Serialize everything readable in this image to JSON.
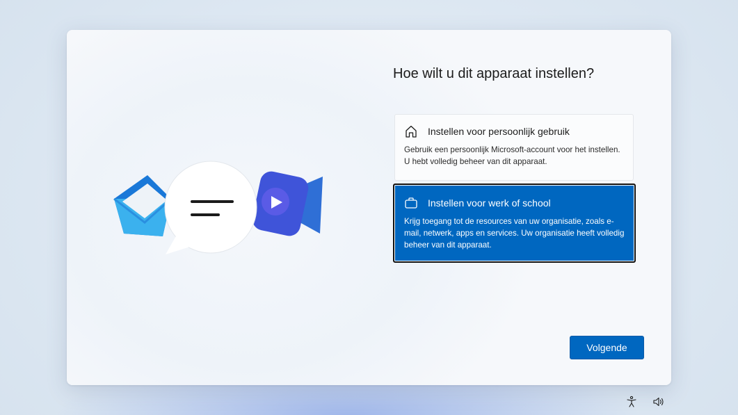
{
  "main": {
    "title": "Hoe wilt u dit apparaat instellen?",
    "options": [
      {
        "icon": "home-icon",
        "title": "Instellen voor persoonlijk gebruik",
        "description": "Gebruik een persoonlijk Microsoft-account voor het instellen. U hebt volledig beheer van dit apparaat.",
        "selected": false
      },
      {
        "icon": "briefcase-icon",
        "title": "Instellen voor werk of school",
        "description": "Krijg toegang tot de resources van uw organisatie, zoals e-mail, netwerk, apps en services. Uw organisatie heeft volledig beheer van dit apparaat.",
        "selected": true
      }
    ],
    "next_button": "Volgende"
  },
  "illustration": {
    "icons": [
      "mail-icon",
      "chat-bubble-icon",
      "video-camera-icon"
    ]
  },
  "tray": {
    "icons": [
      "accessibility-icon",
      "volume-icon"
    ]
  },
  "colors": {
    "accent": "#0067c0",
    "selected_border": "#111111",
    "title_text": "#1b1b1b"
  }
}
